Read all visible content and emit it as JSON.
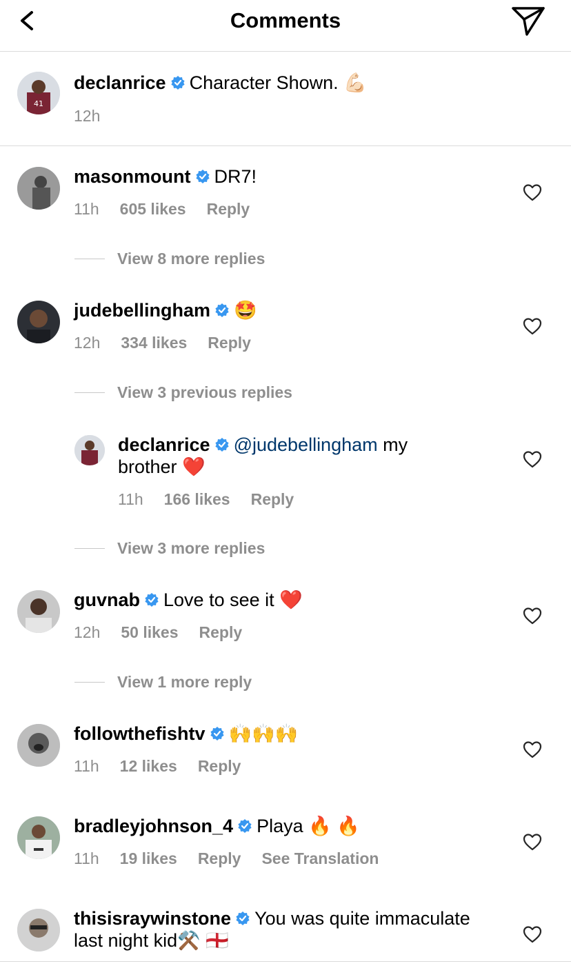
{
  "header": {
    "title": "Comments",
    "back_icon": "chevron-left-icon",
    "share_icon": "paper-plane-icon"
  },
  "caption": {
    "user": "declanrice",
    "text": "Character Shown. 💪🏻",
    "time": "12h"
  },
  "comments": [
    {
      "user": "masonmount",
      "text": "DR7!",
      "time": "11h",
      "likes": "605 likes",
      "reply": "Reply"
    },
    {
      "user": "judebellingham",
      "text": "🤩",
      "time": "12h",
      "likes": "334 likes",
      "reply": "Reply"
    },
    {
      "user": "guvnab",
      "text": "Love to see it ❤️",
      "time": "12h",
      "likes": "50 likes",
      "reply": "Reply"
    },
    {
      "user": "followthefishtv",
      "text": "🙌🙌🙌",
      "time": "11h",
      "likes": "12 likes",
      "reply": "Reply"
    },
    {
      "user": "bradleyjohnson_4",
      "text": "Playa 🔥 🔥",
      "time": "11h",
      "likes": "19 likes",
      "reply": "Reply",
      "translate": "See Translation"
    },
    {
      "user": "thisisraywinstone",
      "text_line1": "You was quite immaculate",
      "text_line2": "last night kid⚒️ 🏴󠁧󠁢󠁥󠁮󠁧󠁿"
    }
  ],
  "nested_reply": {
    "user": "declanrice",
    "mention": "@judebellingham",
    "text_after": " my",
    "text_line2": "brother ❤️",
    "time": "11h",
    "likes": "166 likes",
    "reply": "Reply"
  },
  "view_more": {
    "mason": "View 8 more replies",
    "jude_prev": "View 3 previous replies",
    "jude_more": "View 3 more replies",
    "guvnab": "View 1 more reply"
  },
  "colors": {
    "verified": "#3897f0",
    "meta": "#8e8e8e",
    "mention": "#00376b",
    "divider": "#dbdbdb"
  }
}
